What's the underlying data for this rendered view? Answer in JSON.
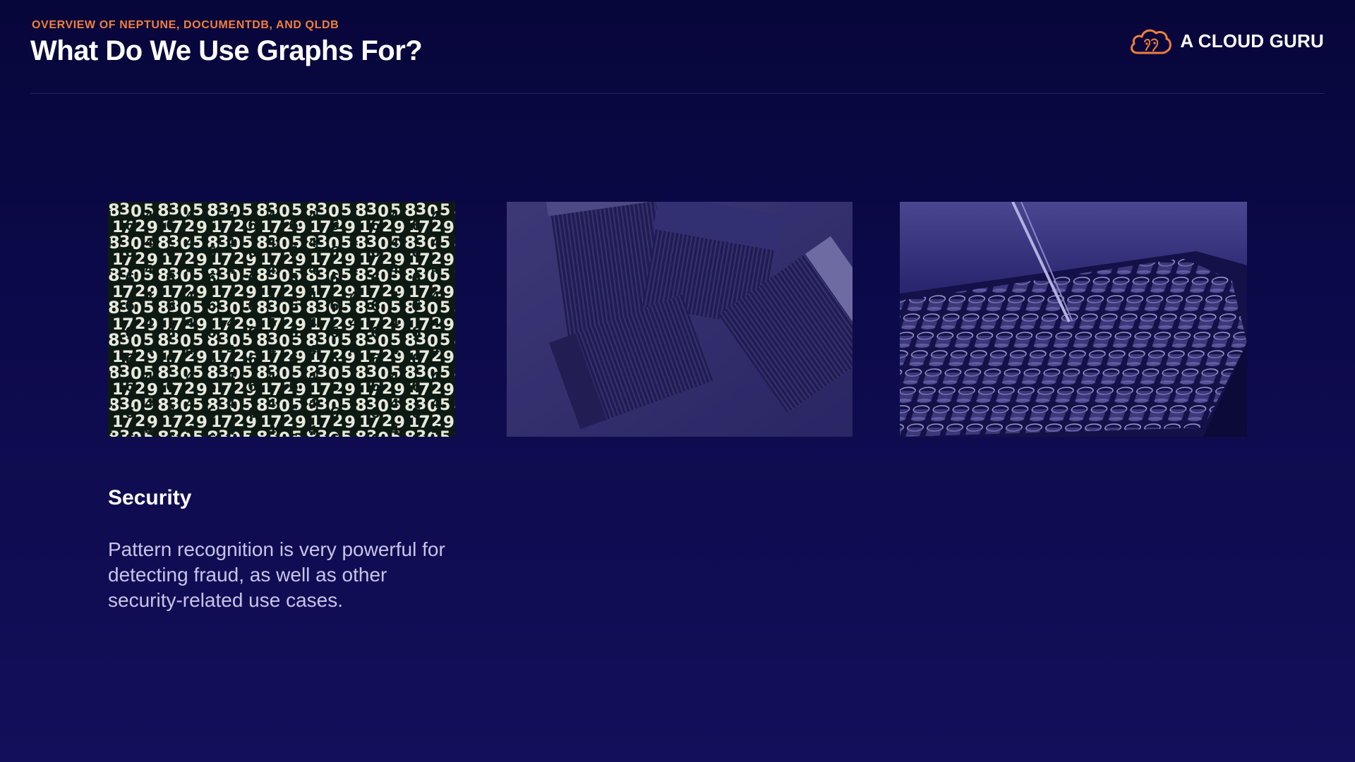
{
  "header": {
    "eyebrow": "OVERVIEW OF NEPTUNE, DOCUMENTDB, AND QLDB",
    "title": "What Do We Use Graphs For?"
  },
  "brand": {
    "name": "A CLOUD GURU",
    "logo_icon": "cloud-logo-icon"
  },
  "colors": {
    "background": "#0d0a4c",
    "accent": "#f07f3c",
    "body_text": "#c8c4e8"
  },
  "cards": [
    {
      "image": "numbers-pattern-image",
      "heading": "Security",
      "body": "Pattern recognition is very powerful for detecting fraud, as well as other security-related use cases."
    },
    {
      "image": "paint-brushes-image"
    },
    {
      "image": "lab-test-tubes-image"
    }
  ]
}
